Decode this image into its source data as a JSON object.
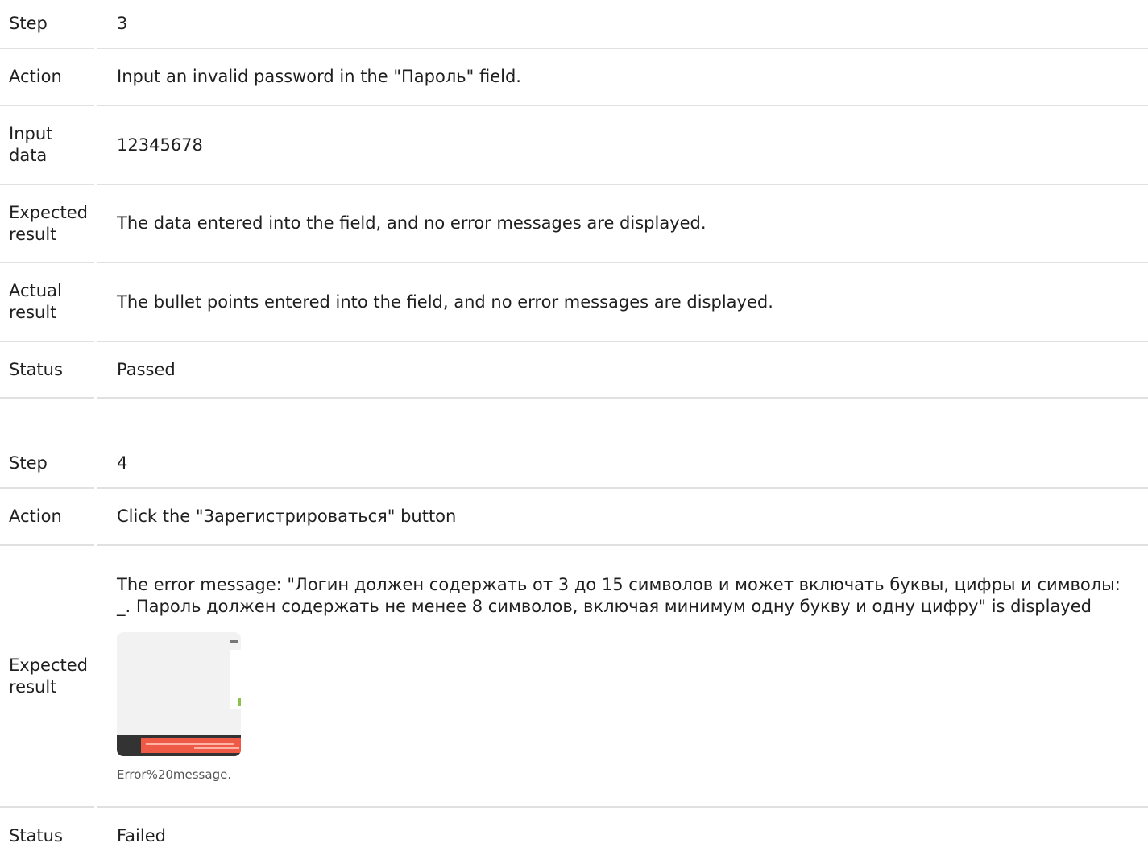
{
  "step3": {
    "rows": [
      {
        "label": "Step",
        "value": "3"
      },
      {
        "label": "Action",
        "value": "Input an invalid password in the \"Пароль\" field."
      },
      {
        "label": "Input data",
        "value": "12345678"
      },
      {
        "label": "Expected result",
        "value": "The data entered into the field, and no error messages are displayed."
      },
      {
        "label": "Actual result",
        "value": "The bullet points entered into the field, and no error messages are displayed."
      },
      {
        "label": "Status",
        "value": "Passed"
      }
    ]
  },
  "step4": {
    "rows": [
      {
        "label": "Step",
        "value": "4"
      },
      {
        "label": "Action",
        "value": "Click the \"Зарегистрироваться\" button"
      },
      {
        "label": "Expected result",
        "value": "The error message: \"Логин должен содержать от 3 до 15 символов и может включать буквы, цифры и символы: _. Пароль должен содержать не менее 8 символов, включая минимум одну букву и одну цифру\" is displayed"
      },
      {
        "label": "Status",
        "value": "Failed"
      }
    ],
    "image_caption": "Error%20message."
  }
}
